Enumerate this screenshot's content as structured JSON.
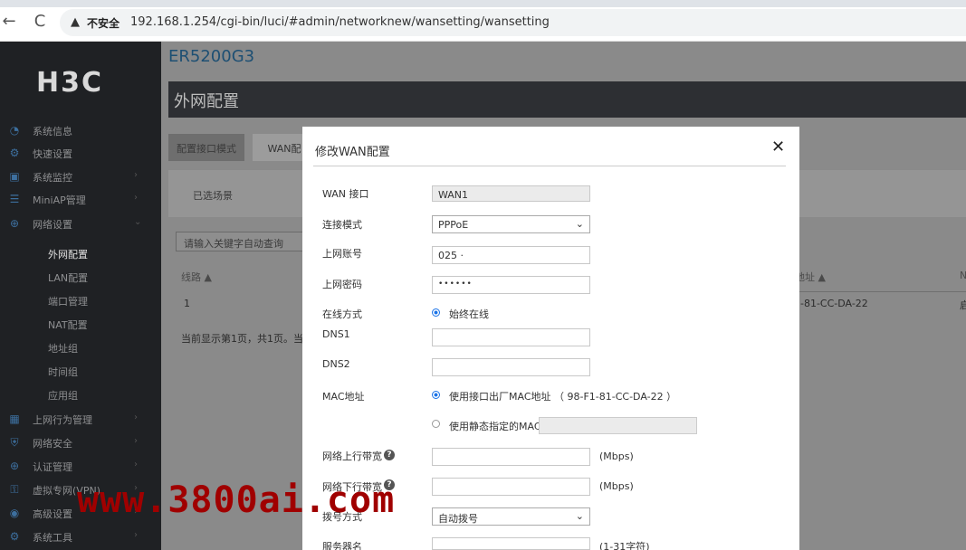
{
  "browser": {
    "back_icon": "←",
    "reload_icon": "C",
    "warning_icon": "▲",
    "insecure_label": "不安全",
    "url": "192.168.1.254/cgi-bin/luci/#admin/networknew/wansetting/wansetting"
  },
  "sidebar": {
    "logo": "H3C",
    "items": [
      {
        "label": "系统信息",
        "icon": "gauge-icon"
      },
      {
        "label": "快速设置",
        "icon": "wizard-icon"
      },
      {
        "label": "系统监控",
        "icon": "monitor-icon"
      },
      {
        "label": "MiniAP管理",
        "icon": "wifi-icon"
      },
      {
        "label": "网络设置",
        "icon": "globe-icon"
      },
      {
        "label": "上网行为管理",
        "icon": "behavior-icon"
      },
      {
        "label": "网络安全",
        "icon": "shield-icon"
      },
      {
        "label": "认证管理",
        "icon": "auth-icon"
      },
      {
        "label": "虚拟专网(VPN)",
        "icon": "vpn-icon"
      },
      {
        "label": "高级设置",
        "icon": "advanced-icon"
      },
      {
        "label": "系统工具",
        "icon": "tools-icon"
      }
    ],
    "subitems": [
      "外网配置",
      "LAN配置",
      "端口管理",
      "NAT配置",
      "地址组",
      "时间组",
      "应用组"
    ]
  },
  "main": {
    "model": "ER5200G3",
    "page_title": "外网配置",
    "tabs": [
      "配置接口模式",
      "WAN配"
    ],
    "panel_text": "已选场景",
    "search_placeholder": "请输入关键字自动查询",
    "col_line": "线路 ▲",
    "row_line": "1",
    "page_info": "当前显示第1页，共1页。当前",
    "col_addr": "地址 ▲",
    "col_n": "N",
    "row_mac": "-81-CC-DA-22",
    "row_n": "启"
  },
  "modal": {
    "title": "修改WAN配置",
    "close": "✕",
    "wan_label": "WAN 接口",
    "wan_value": "WAN1",
    "mode_label": "连接模式",
    "mode_value": "PPPoE",
    "account_label": "上网账号",
    "account_value": "025  ·",
    "password_label": "上网密码",
    "password_value": "••••••",
    "online_label": "在线方式",
    "online_option": "始终在线",
    "dns1_label": "DNS1",
    "dns1_value": "",
    "dns2_label": "DNS2",
    "dns2_value": "",
    "mac_label": "MAC地址",
    "mac_option1": "使用接口出厂MAC地址  （ 98-F1-81-CC-DA-22 ）",
    "mac_option2": "使用静态指定的MAC",
    "up_label": "网络上行带宽",
    "up_unit": "(Mbps)",
    "down_label": "网络下行带宽",
    "down_unit": "(Mbps)",
    "dial_label": "拨号方式",
    "dial_value": "自动拨号",
    "server_label": "服务器名",
    "server_unit": "(1-31字符)",
    "help_icon": "?",
    "chevron": "⌄"
  },
  "watermark": "www.3800ai.com"
}
